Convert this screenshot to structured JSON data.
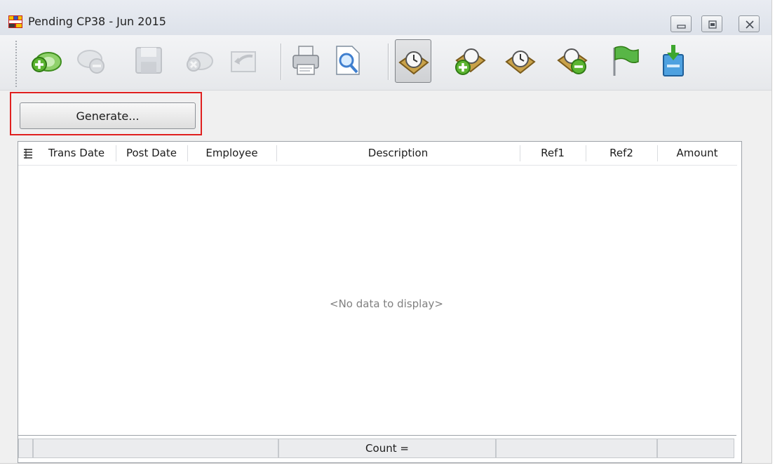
{
  "window": {
    "title": "Pending CP38 - Jun 2015",
    "controls": [
      "minimize",
      "maximize",
      "close"
    ]
  },
  "toolbar": {
    "buttons": [
      {
        "icon": "add-money-icon",
        "enabled": true
      },
      {
        "icon": "delete-money-icon",
        "enabled": false
      },
      {
        "icon": "save-icon",
        "enabled": false
      },
      {
        "icon": "cancel-icon",
        "enabled": false
      },
      {
        "icon": "undo-icon",
        "enabled": false
      },
      {
        "icon": "print-icon",
        "enabled": true
      },
      {
        "icon": "preview-icon",
        "enabled": true
      },
      {
        "icon": "pending-clock-icon",
        "enabled": true,
        "active": true
      },
      {
        "icon": "add-clock-icon",
        "enabled": true
      },
      {
        "icon": "clock-icon",
        "enabled": true
      },
      {
        "icon": "remove-clock-icon",
        "enabled": true
      },
      {
        "icon": "green-flag-icon",
        "enabled": true
      },
      {
        "icon": "export-cabinet-icon",
        "enabled": true
      }
    ]
  },
  "actions": {
    "generate_label": "Generate..."
  },
  "grid": {
    "columns": [
      "Trans Date",
      "Post Date",
      "Employee",
      "Description",
      "Ref1",
      "Ref2",
      "Amount"
    ],
    "rows": [],
    "empty_message": "<No data to display>",
    "footer": {
      "count_label": "Count ="
    }
  },
  "colors": {
    "highlight": "#e0201f",
    "accent_green": "#5cb531",
    "accent_gold": "#c9a24a"
  }
}
